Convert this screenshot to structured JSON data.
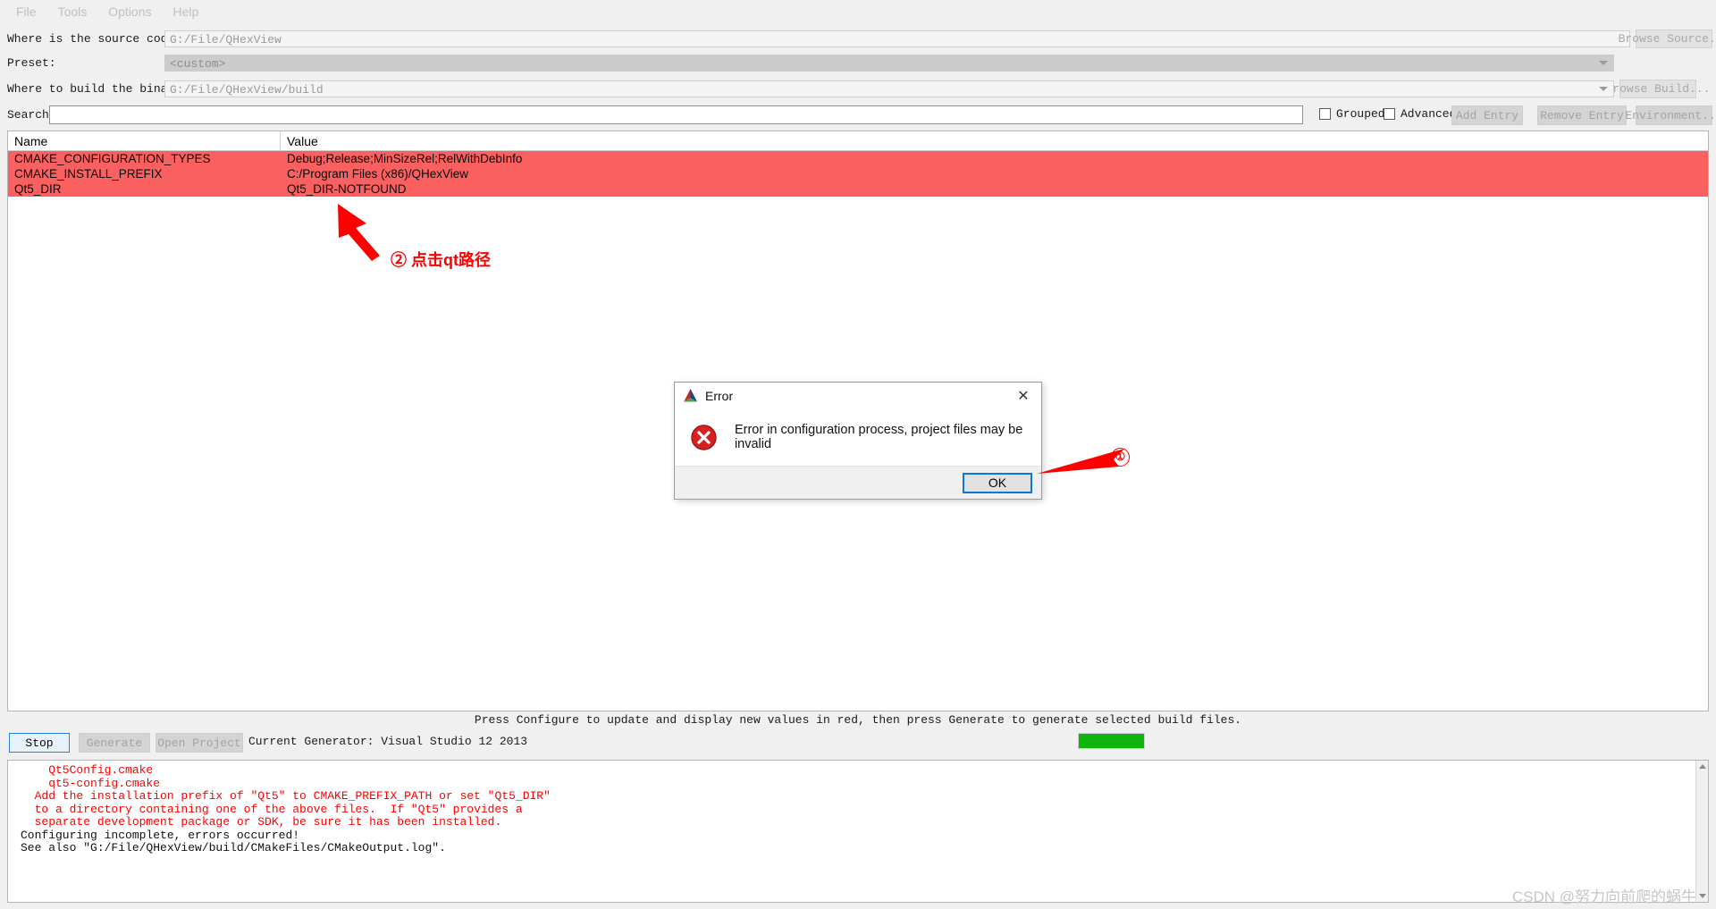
{
  "menu": {
    "items": [
      {
        "label": "File"
      },
      {
        "label": "Tools"
      },
      {
        "label": "Options"
      },
      {
        "label": "Help"
      }
    ]
  },
  "form": {
    "source_label": "Where is the source code:",
    "source_value": "G:/File/QHexView",
    "browse_source_label": "Browse Source...",
    "preset_label": "Preset:",
    "preset_value": "<custom>",
    "build_label": "Where to build the binaries:",
    "build_value": "G:/File/QHexView/build",
    "browse_build_label": "Browse Build..."
  },
  "toolbar": {
    "search_label": "Search:",
    "search_value": "",
    "grouped_label": "Grouped",
    "advanced_label": "Advanced",
    "add_entry_label": "Add Entry",
    "remove_entry_label": "Remove Entry",
    "environment_label": "Environment..."
  },
  "table": {
    "columns": [
      "Name",
      "Value"
    ],
    "rows": [
      {
        "name": "CMAKE_CONFIGURATION_TYPES",
        "value": "Debug;Release;MinSizeRel;RelWithDebInfo"
      },
      {
        "name": "CMAKE_INSTALL_PREFIX",
        "value": "C:/Program Files (x86)/QHexView"
      },
      {
        "name": "Qt5_DIR",
        "value": "Qt5_DIR-NOTFOUND"
      }
    ],
    "row_highlight_color": "#fa6060"
  },
  "annotations": {
    "step_two": "② 点击qt路径",
    "step_one": "①",
    "arrow_color": "#ff0000"
  },
  "status": {
    "hint": "Press Configure to update and display new values in red, then press Generate to generate selected build files.",
    "progress_percent": 100,
    "progress_color": "#0fb40f"
  },
  "actions": {
    "stop_label": "Stop",
    "generate_label": "Generate",
    "open_project_label": "Open Project",
    "current_generator": "Current Generator: Visual Studio 12 2013"
  },
  "log": {
    "lines": [
      {
        "text": "    Qt5Config.cmake",
        "color": "red"
      },
      {
        "text": "    qt5-config.cmake",
        "color": "red"
      },
      {
        "text": "",
        "color": "red"
      },
      {
        "text": "  Add the installation prefix of \"Qt5\" to CMAKE_PREFIX_PATH or set \"Qt5_DIR\"",
        "color": "red"
      },
      {
        "text": "  to a directory containing one of the above files.  If \"Qt5\" provides a",
        "color": "red"
      },
      {
        "text": "  separate development package or SDK, be sure it has been installed.",
        "color": "red"
      },
      {
        "text": "",
        "color": "red"
      },
      {
        "text": "",
        "color": "black"
      },
      {
        "text": "Configuring incomplete, errors occurred!",
        "color": "black"
      },
      {
        "text": "See also \"G:/File/QHexView/build/CMakeFiles/CMakeOutput.log\".",
        "color": "black"
      }
    ]
  },
  "dialog": {
    "title": "Error",
    "message": "Error in configuration process, project files may be invalid",
    "ok_label": "OK",
    "close_label": "✕"
  },
  "watermark": {
    "text": "CSDN @努力向前爬的蜗牛"
  }
}
